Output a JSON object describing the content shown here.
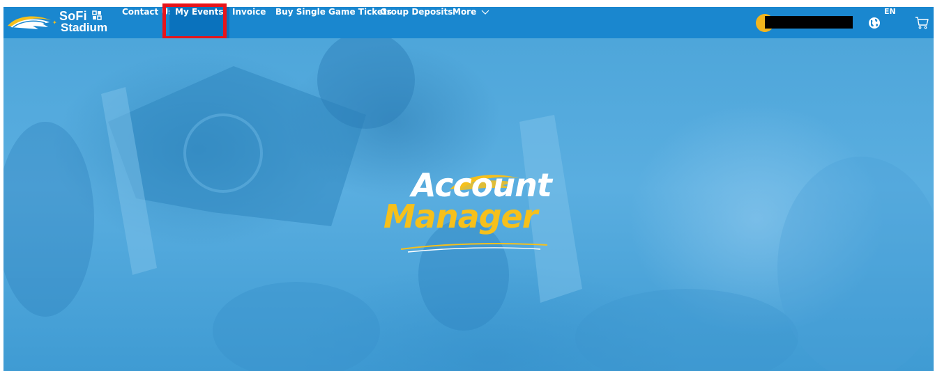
{
  "nav": {
    "brand": {
      "name": "SoFi",
      "sub": "Stadium"
    },
    "items": [
      {
        "label": "Contact Us"
      },
      {
        "label": "My Events"
      },
      {
        "label": "Invoice"
      },
      {
        "label": "Buy Single Game Tickets"
      },
      {
        "label": "Group Deposits"
      },
      {
        "label": "More"
      }
    ],
    "language": "EN"
  },
  "hero": {
    "title_line1": "Account",
    "title_line2": "Manager"
  },
  "colors": {
    "nav_bg": "#1a87cf",
    "active_bg": "#0a72bd",
    "highlight": "#e8141a",
    "accent_gold": "#f6c01b",
    "hero_blue": "#4ea6da"
  },
  "icons": [
    "chargers-bolt-logo",
    "sofi-logo-mark",
    "chevron-down-icon",
    "avatar",
    "globe-icon",
    "cart-icon"
  ]
}
